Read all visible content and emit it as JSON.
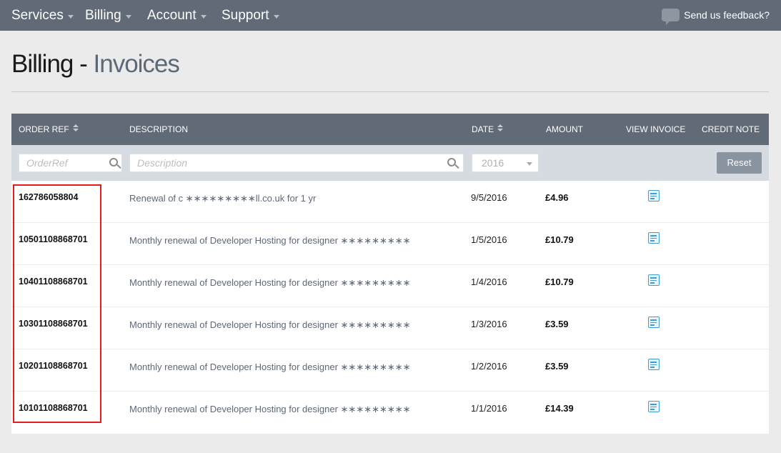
{
  "nav": {
    "items": [
      {
        "label": "Services"
      },
      {
        "label": "Billing"
      },
      {
        "label": "Account"
      },
      {
        "label": "Support"
      }
    ],
    "feedback_label": "Send us feedback?"
  },
  "page": {
    "title_main": "Billing -",
    "title_sub": "Invoices"
  },
  "table": {
    "columns": {
      "order_ref": "ORDER REF",
      "description": "DESCRIPTION",
      "date": "DATE",
      "amount": "AMOUNT",
      "view_invoice": "VIEW INVOICE",
      "credit_note": "CREDIT NOTE"
    },
    "filters": {
      "order_ref_placeholder": "OrderRef",
      "description_placeholder": "Description",
      "year_value": "2016",
      "reset_label": "Reset"
    },
    "rows": [
      {
        "ref": "162786058804",
        "description": "Renewal of c ∗∗∗∗∗∗∗∗∗ll.co.uk for 1 yr",
        "date": "9/5/2016",
        "amount": "£4.96"
      },
      {
        "ref": "10501108868701",
        "description": "Monthly renewal of Developer Hosting for designer ∗∗∗∗∗∗∗∗∗",
        "date": "1/5/2016",
        "amount": "£10.79"
      },
      {
        "ref": "10401108868701",
        "description": "Monthly renewal of Developer Hosting for designer ∗∗∗∗∗∗∗∗∗",
        "date": "1/4/2016",
        "amount": "£10.79"
      },
      {
        "ref": "10301108868701",
        "description": "Monthly renewal of Developer Hosting for designer ∗∗∗∗∗∗∗∗∗",
        "date": "1/3/2016",
        "amount": "£3.59"
      },
      {
        "ref": "10201108868701",
        "description": "Monthly renewal of Developer Hosting for designer ∗∗∗∗∗∗∗∗∗",
        "date": "1/2/2016",
        "amount": "£3.59"
      },
      {
        "ref": "10101108868701",
        "description": "Monthly renewal of Developer Hosting for designer ∗∗∗∗∗∗∗∗∗",
        "date": "1/1/2016",
        "amount": "£14.39"
      }
    ]
  },
  "icons": {
    "nav_caret": "chevron-down-icon",
    "feedback": "chat-bubble-icon",
    "sort": "sort-icon",
    "search": "search-icon",
    "view_invoice": "document-icon"
  },
  "colors": {
    "nav_bg": "#616a77",
    "accent_link": "#3b9fd6",
    "highlight": "#e21b1b"
  }
}
